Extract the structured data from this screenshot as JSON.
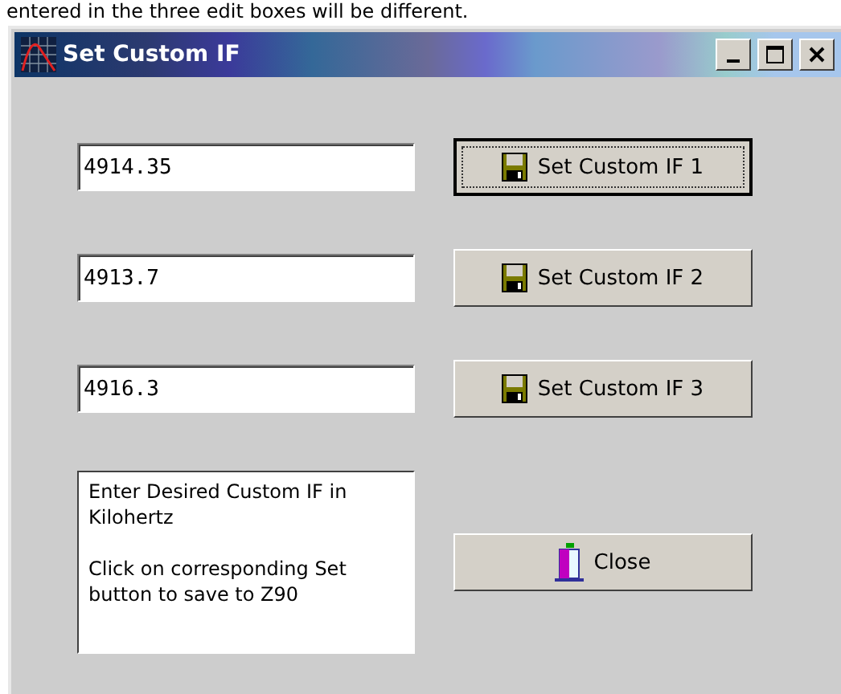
{
  "caption": "entered in the three edit boxes will be different.",
  "window": {
    "title": "Set Custom IF"
  },
  "rows": [
    {
      "value": "4914.35",
      "button": "Set Custom IF 1",
      "focused": true
    },
    {
      "value": "4913.7",
      "button": "Set Custom IF 2",
      "focused": false
    },
    {
      "value": "4916.3",
      "button": "Set Custom IF 3",
      "focused": false
    }
  ],
  "info": [
    "Enter Desired Custom IF in Kilohertz",
    "Click on corresponding Set button to save to Z90"
  ],
  "close_button": "Close"
}
